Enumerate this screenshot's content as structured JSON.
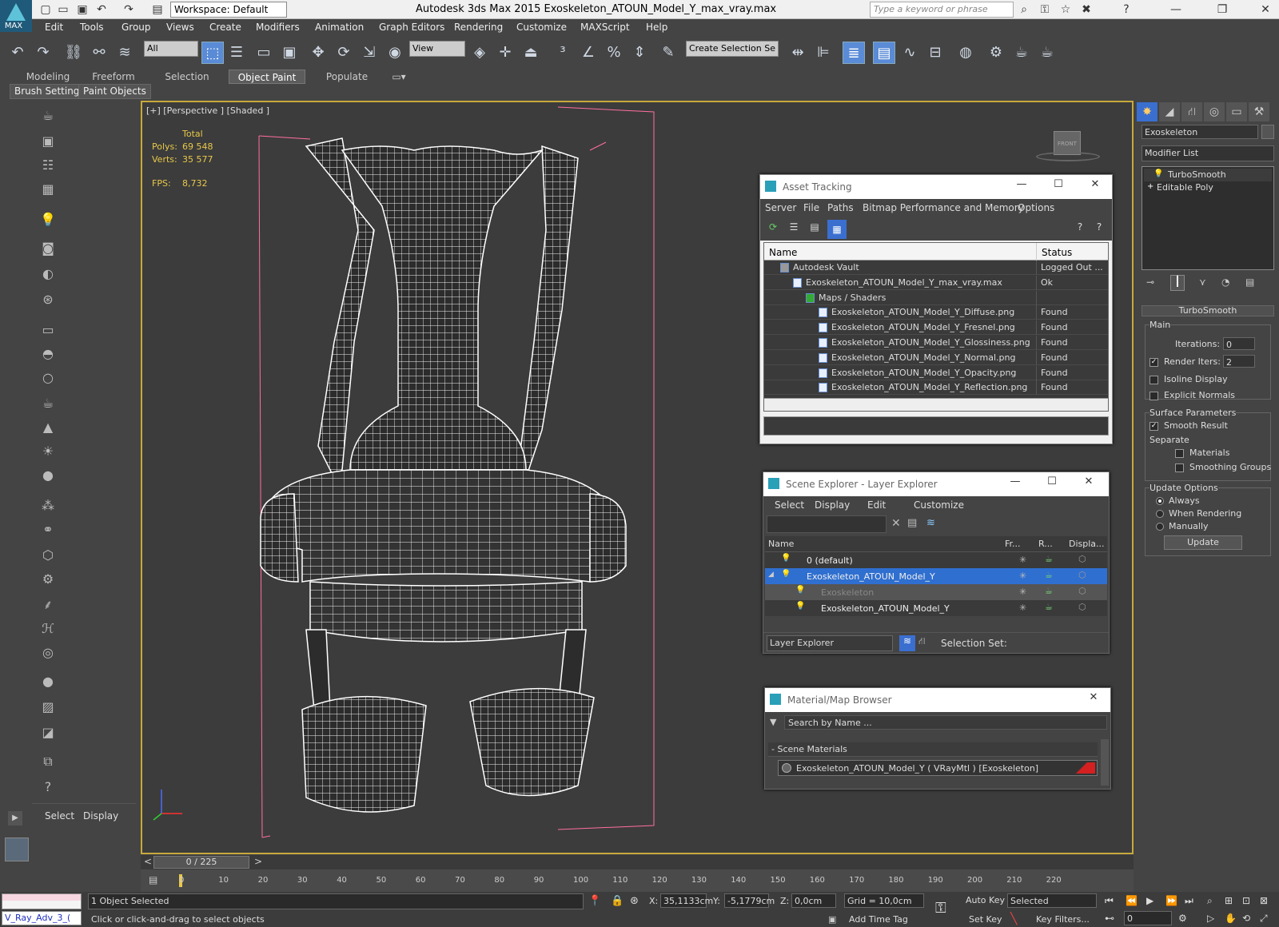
{
  "app": {
    "workspace": "Workspace: Default",
    "title": "Autodesk 3ds Max  2015     Exoskeleton_ATOUN_Model_Y_max_vray.max",
    "keyword_placeholder": "Type a keyword or phrase",
    "logo_label": "MAX"
  },
  "menu": [
    "Edit",
    "Tools",
    "Group",
    "Views",
    "Create",
    "Modifiers",
    "Animation",
    "Graph Editors",
    "Rendering",
    "Customize",
    "MAXScript",
    "Help"
  ],
  "toolbar": {
    "filter": "All",
    "view": "View",
    "selection_set": "Create Selection Se"
  },
  "ribbon": {
    "tabs": [
      "Modeling",
      "Freeform",
      "Selection",
      "Object Paint",
      "Populate"
    ],
    "active_tab": "Object Paint",
    "buttons": [
      "Brush Settings",
      "Paint Objects"
    ]
  },
  "viewport": {
    "label": "[+] [Perspective ] [Shaded ]",
    "stats_header": "Total",
    "polys_label": "Polys:",
    "polys": "69 548",
    "verts_label": "Verts:",
    "verts": "35 577",
    "fps_label": "FPS:",
    "fps": "8,732",
    "viewcube": "FRONT"
  },
  "command_panel": {
    "object_name": "Exoskeleton",
    "modifier_list": "Modifier List",
    "stack": [
      "TurboSmooth",
      "Editable Poly"
    ],
    "rollout_title": "TurboSmooth",
    "main_label": "Main",
    "iterations_label": "Iterations:",
    "iterations": "0",
    "render_iters_label": "Render Iters:",
    "render_iters": "2",
    "isoline": "Isoline Display",
    "explicit_normals": "Explicit Normals",
    "surface_params": "Surface Parameters",
    "smooth_result": "Smooth Result",
    "separate": "Separate",
    "materials": "Materials",
    "smoothing_groups": "Smoothing Groups",
    "update_options": "Update Options",
    "always": "Always",
    "when_rendering": "When Rendering",
    "manually": "Manually",
    "update_button": "Update"
  },
  "asset_tracking": {
    "title": "Asset Tracking",
    "menu": [
      "Server",
      "File",
      "Paths",
      "Bitmap Performance and Memory",
      "Options"
    ],
    "col_name": "Name",
    "col_status": "Status",
    "rows": [
      {
        "name": "Autodesk Vault",
        "status": "Logged Out ...",
        "indent": 1
      },
      {
        "name": "Exoskeleton_ATOUN_Model_Y_max_vray.max",
        "status": "Ok",
        "indent": 2
      },
      {
        "name": "Maps / Shaders",
        "status": "",
        "indent": 3
      },
      {
        "name": "Exoskeleton_ATOUN_Model_Y_Diffuse.png",
        "status": "Found",
        "indent": 4
      },
      {
        "name": "Exoskeleton_ATOUN_Model_Y_Fresnel.png",
        "status": "Found",
        "indent": 4
      },
      {
        "name": "Exoskeleton_ATOUN_Model_Y_Glossiness.png",
        "status": "Found",
        "indent": 4
      },
      {
        "name": "Exoskeleton_ATOUN_Model_Y_Normal.png",
        "status": "Found",
        "indent": 4
      },
      {
        "name": "Exoskeleton_ATOUN_Model_Y_Opacity.png",
        "status": "Found",
        "indent": 4
      },
      {
        "name": "Exoskeleton_ATOUN_Model_Y_Reflection.png",
        "status": "Found",
        "indent": 4
      }
    ]
  },
  "scene_explorer": {
    "title": "Scene Explorer - Layer Explorer",
    "menu": [
      "Select",
      "Display",
      "Edit",
      "Customize"
    ],
    "col_name": "Name",
    "col_fr": "Fr...",
    "col_r": "R...",
    "col_disp": "Displa...",
    "rows": [
      {
        "name": "0 (default)",
        "selected": false,
        "indent": 0
      },
      {
        "name": "Exoskeleton_ATOUN_Model_Y",
        "selected": true,
        "indent": 0
      },
      {
        "name": "Exoskeleton",
        "selected": false,
        "indent": 1
      },
      {
        "name": "Exoskeleton_ATOUN_Model_Y",
        "selected": false,
        "indent": 1
      }
    ],
    "footer_dropdown": "Layer Explorer",
    "selection_set": "Selection Set:"
  },
  "material_browser": {
    "title": "Material/Map Browser",
    "search_placeholder": "Search by Name ...",
    "group": "- Scene Materials",
    "item": "Exoskeleton_ATOUN_Model_Y ( VRayMtl ) [Exoskeleton]"
  },
  "left_panel": {
    "select": "Select",
    "display": "Display"
  },
  "timeline": {
    "frame": "0 / 225",
    "ticks": [
      "0",
      "10",
      "20",
      "30",
      "40",
      "50",
      "60",
      "70",
      "80",
      "90",
      "100",
      "110",
      "120",
      "130",
      "140",
      "150",
      "160",
      "170",
      "180",
      "190",
      "200",
      "210",
      "220"
    ]
  },
  "status": {
    "script_field": "V_Ray_Adv_3_(",
    "selected": "1 Object Selected",
    "prompt": "Click or click-and-drag to select objects",
    "x_label": "X:",
    "x": "35,1133cm",
    "y_label": "Y:",
    "y": "-5,1779cm",
    "z_label": "Z:",
    "z": "0,0cm",
    "grid": "Grid = 10,0cm",
    "add_time_tag": "Add Time Tag",
    "auto_key": "Auto Key",
    "set_key": "Set Key",
    "selected_dropdown": "Selected",
    "key_filters": "Key Filters...",
    "frame_field": "0"
  },
  "colors": {
    "viewport_border": "#c8a93b",
    "stats": "#e8c84a",
    "selection_blue": "#2f6fd0",
    "wireframe": "#ffffff",
    "frame_lines": "#ff6fa0"
  }
}
